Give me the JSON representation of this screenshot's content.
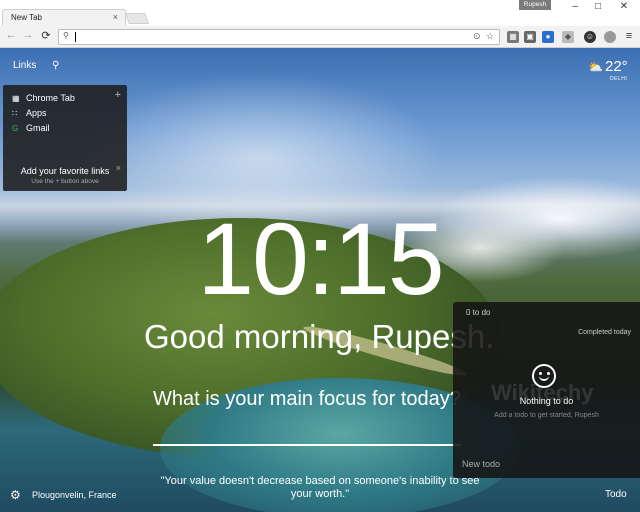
{
  "browser": {
    "tab_title": "New Tab",
    "tab_close": "×",
    "profile_name": "Rupesh",
    "window_controls": {
      "minimize": "–",
      "maximize": "□",
      "close": "✕"
    },
    "nav": {
      "back": "←",
      "forward": "→",
      "reload": "⟳"
    },
    "omnibox": {
      "value": "",
      "placeholder": ""
    },
    "menu_icon": "≡"
  },
  "links": {
    "label": "Links",
    "items": [
      {
        "label": "Chrome Tab",
        "icon": "grid-icon"
      },
      {
        "label": "Apps",
        "icon": "apps-grid-icon"
      },
      {
        "label": "Gmail",
        "icon": "google-icon"
      }
    ],
    "hint_title": "Add your favorite links",
    "hint_sub": "Use the + button above"
  },
  "weather": {
    "temperature": "22°",
    "location": "DELHI",
    "icon": "sun-cloud-icon"
  },
  "clock": {
    "time": "10:15"
  },
  "greeting": "Good morning, Rupesh.",
  "focus_prompt": "What is your main focus for today?",
  "quote": "\"Your value doesn't decrease based on someone's inability to see your worth.\"",
  "location_label": "Plougonvelin, France",
  "todo": {
    "count_label": "0 to do",
    "completed_label": "Completed today",
    "empty_title": "Nothing to do",
    "empty_sub": "Add a todo to get started, Rupesh",
    "new_placeholder": "New todo",
    "button_label": "Todo",
    "watermark": "Wikitechy"
  }
}
